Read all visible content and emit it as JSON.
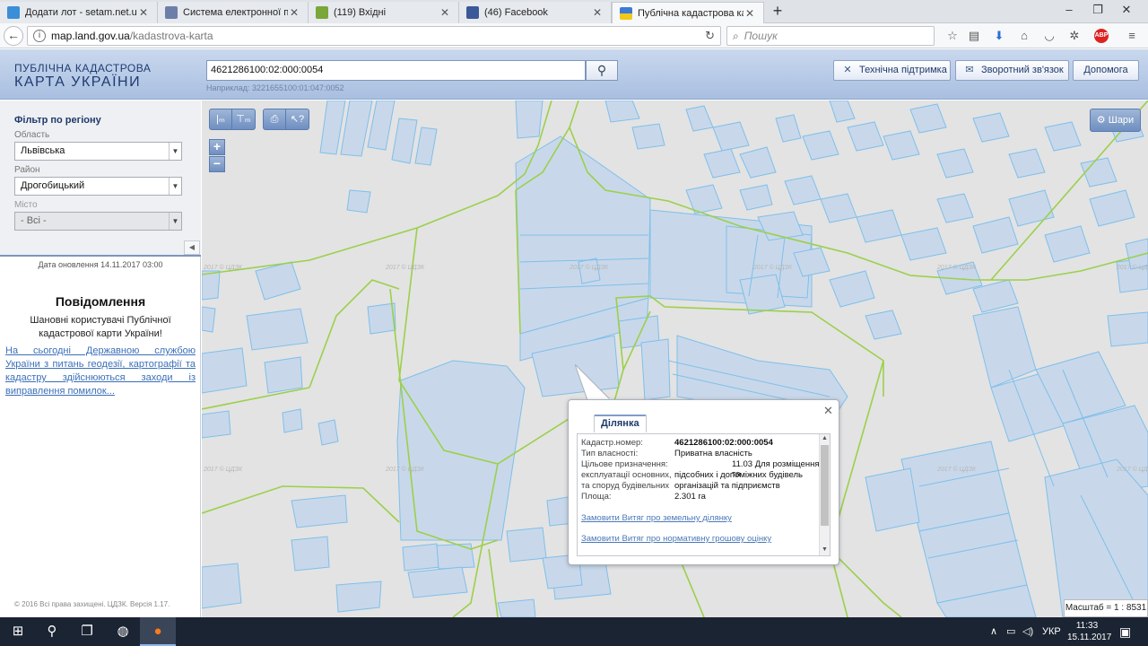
{
  "browser": {
    "tabs": [
      {
        "title": "Додати лот - setam.net.ua",
        "favicon_color": "#3b8ed8"
      },
      {
        "title": "Система електронної пошт",
        "favicon_color": "#6d7fa8"
      },
      {
        "title": "(119) Вхідні",
        "favicon_color": "#7aa63a"
      },
      {
        "title": "(46) Facebook",
        "favicon_color": "#3b5998"
      },
      {
        "title": "Публічна кадастрова карта",
        "favicon_color": "#e8c41a"
      }
    ],
    "url_host": "map.land.gov.ua",
    "url_path": "/kadastrova-karta",
    "search_placeholder": "Пошук"
  },
  "header": {
    "logo_line1": "ПУБЛІЧНА КАДАСТРОВА",
    "logo_line2": "КАРТА УКРАЇНИ",
    "search_value": "4621286100:02:000:0054",
    "search_example": "Наприклад: 3221655100:01:047:0052",
    "buttons": {
      "support": "Технічна підтримка",
      "feedback": "Зворотний зв'язок",
      "help": "Допомога"
    }
  },
  "sidebar": {
    "filter_title": "Фільтр по регіону",
    "region_label": "Область",
    "region_value": "Львівська",
    "district_label": "Район",
    "district_value": "Дрогобицький",
    "city_label": "Місто",
    "city_value": "- Всі -",
    "updated": "Дата оновлення  14.11.2017 03:00",
    "notice_title": "Повідомлення",
    "notice_text": "Шановні користувачі Публічної кадастрової карти України!",
    "notice_link": "На сьогодні Державною службою України з питань геодезії, картографії та кадастру здійснюються заходи із виправлення помилок...",
    "copyright": "© 2016 Всі права захищені. ЦДЗК. Версія 1.17."
  },
  "map": {
    "layers_label": "Шари",
    "scale_label": "Масштаб = 1 : 8531",
    "watermark": "2017 © ЦДЗК",
    "colors": {
      "background": "#e3e3e3",
      "parcel_fill": "#c8d8ea",
      "parcel_stroke": "#7fbfea",
      "boundary": "#9bd04a"
    }
  },
  "popup": {
    "tab_label": "Ділянка",
    "fields": [
      {
        "key": "Кадастр.номер:",
        "value": "4621286100:02:000:0054"
      },
      {
        "key": "Тип власності:",
        "value": "Приватна власність"
      },
      {
        "key": "Цільове призначення:",
        "value": "11.03 Для розміщення та"
      },
      {
        "key": "експлуатації основних,",
        "value": "підсобних і допоміжних будівель"
      },
      {
        "key": "та споруд будівельних",
        "value": "організацій та підприємств"
      },
      {
        "key": "Площа:",
        "value": "2.301 га"
      }
    ],
    "link1": "Замовити Витяг про земельну ділянку",
    "link2": "Замовити Витяг про нормативну грошову оцінку"
  },
  "taskbar": {
    "lang": "УКР",
    "time": "11:33",
    "date": "15.11.2017"
  }
}
